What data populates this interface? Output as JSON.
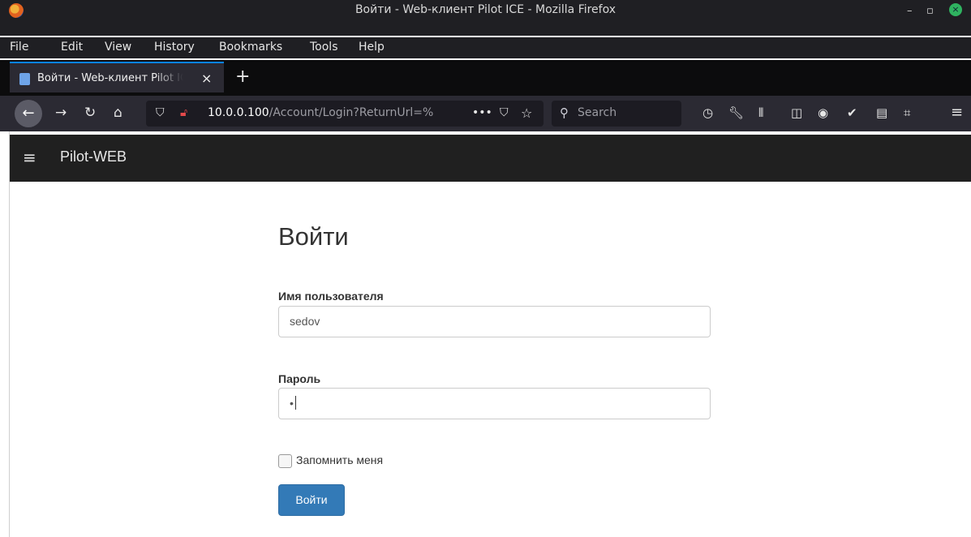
{
  "window": {
    "title": "Войти - Web-клиент Pilot ICE - Mozilla Firefox",
    "minimize": "–",
    "maximize": "▫",
    "close": "×"
  },
  "menu": {
    "items": [
      "File",
      "Edit",
      "View",
      "History",
      "Bookmarks",
      "Tools",
      "Help"
    ]
  },
  "tabs": {
    "active_label": "Войти - Web-клиент Pilot ICE",
    "close": "×",
    "new_tab": "+"
  },
  "navbar": {
    "back": "←",
    "forward": "→",
    "reload": "↻",
    "home": "⌂",
    "url_host": "10.0.0.100",
    "url_path": "/Account/Login?ReturnUrl=%",
    "more": "•••",
    "search_placeholder": "Search"
  },
  "icons": {
    "shield": "⛉",
    "lock": "🔓︎",
    "pocket": "⛉",
    "bookmark_star": "☆",
    "search": "⚲",
    "history": "◷",
    "tools": "🔧︎",
    "library": "⫴",
    "sidebar": "◫",
    "account": "◉",
    "extension": "✔",
    "reader": "▤",
    "grid": "⌗",
    "menu": "≡"
  },
  "site": {
    "brand": "Pilot-WEB",
    "hamburger": "≡"
  },
  "login": {
    "title": "Войти",
    "username_label": "Имя пользователя",
    "username_value": "sedov",
    "password_label": "Пароль",
    "password_value": "•",
    "remember_label": "Запомнить меня",
    "remember_checked": false,
    "submit_label": "Войти"
  },
  "colors": {
    "primary_button": "#337ab7",
    "site_nav_bg": "#202020",
    "tab_accent": "#0a84ff"
  }
}
